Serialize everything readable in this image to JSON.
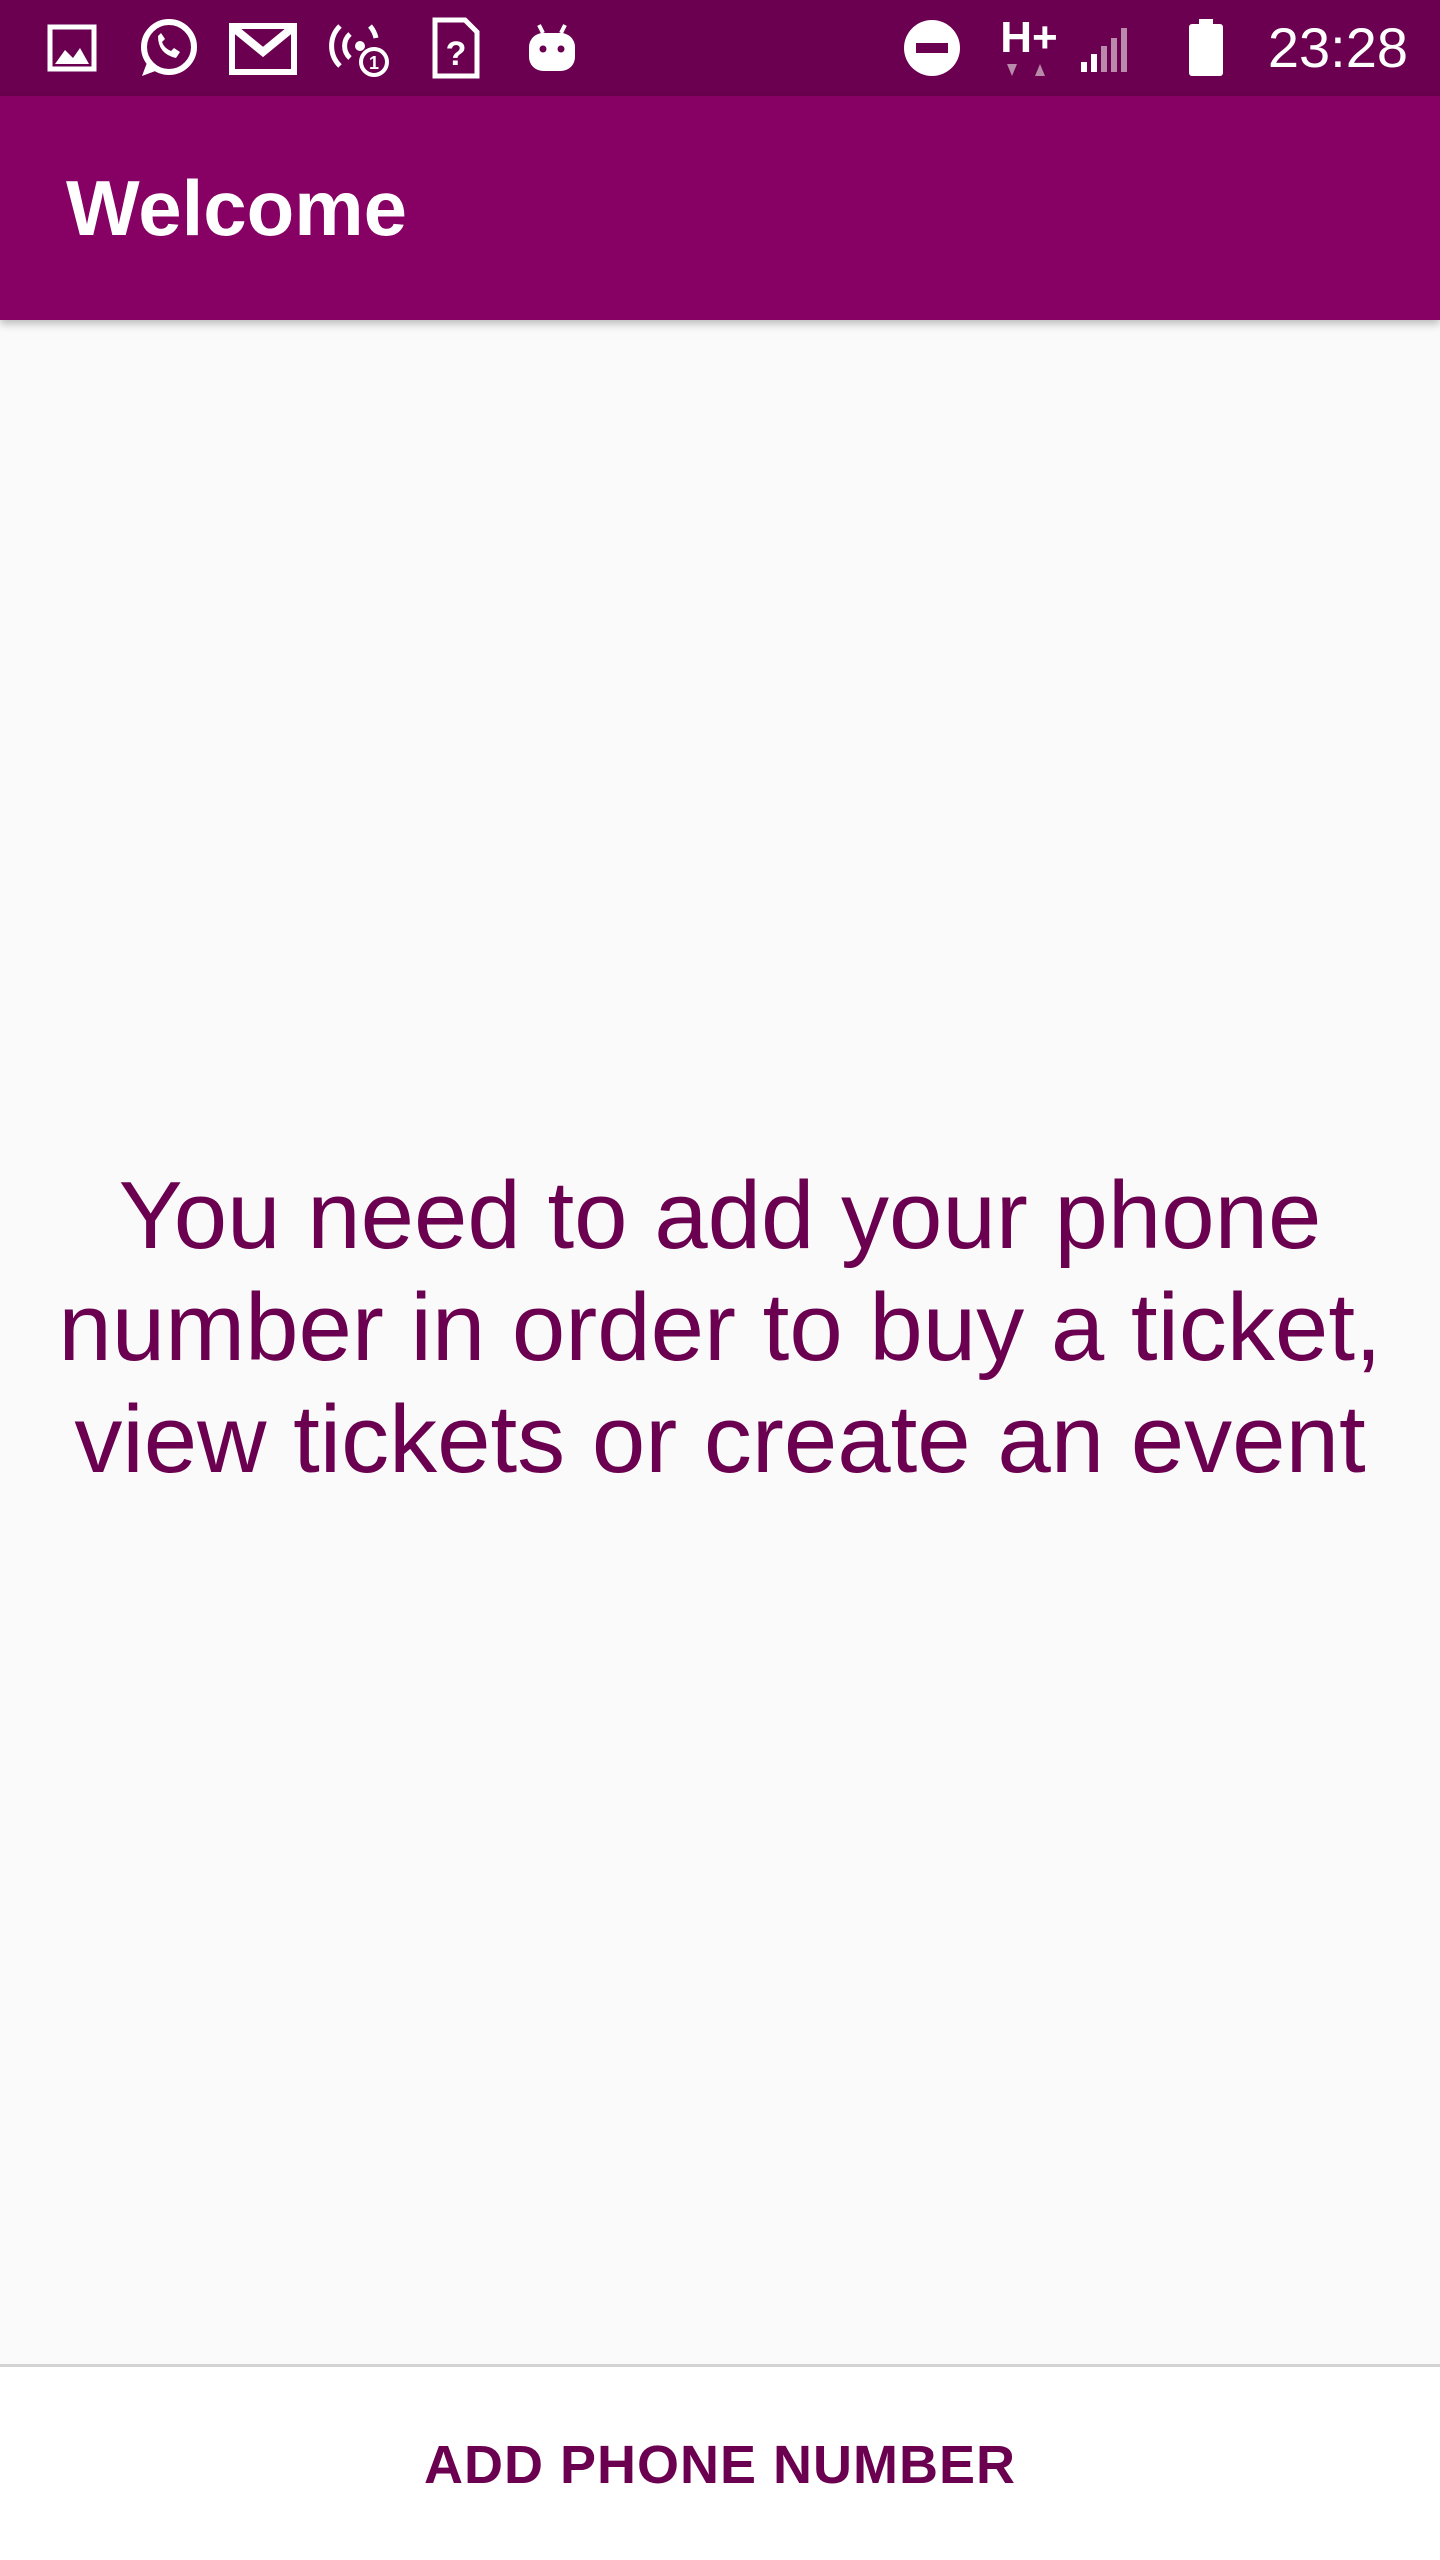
{
  "status_bar": {
    "time": "23:28",
    "network_type": "H+",
    "left_icons": [
      "image-icon",
      "whatsapp-icon",
      "gmail-icon",
      "hotspot-icon",
      "sim-unknown-icon",
      "android-icon"
    ],
    "right_icons": [
      "do-not-disturb-icon",
      "network-type-icon",
      "signal-icon",
      "battery-icon"
    ],
    "background_color": "#6a004f"
  },
  "app_bar": {
    "title": "Welcome",
    "background_color": "#870064"
  },
  "main": {
    "message": "You need to add your phone number in order to buy a ticket, view tickets or create an event",
    "text_color": "#6a004f"
  },
  "bottom_bar": {
    "button_label": "ADD PHONE NUMBER"
  }
}
